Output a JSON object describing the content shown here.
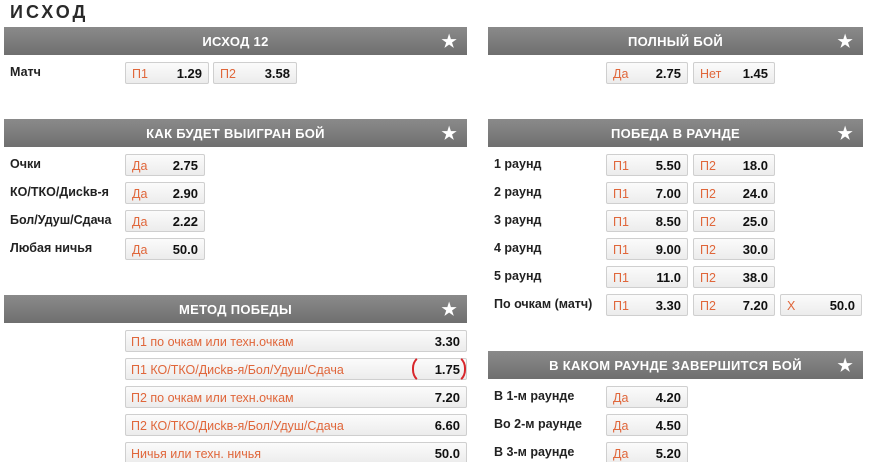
{
  "page_title": "ИСХОД",
  "panels": {
    "outcome12": {
      "title": "ИСХОД 12",
      "rows": [
        {
          "label": "Матч",
          "odds": [
            {
              "label": "П1",
              "value": "1.29"
            },
            {
              "label": "П2",
              "value": "3.58"
            }
          ]
        }
      ]
    },
    "full_fight": {
      "title": "ПОЛНЫЙ БОЙ",
      "rows": [
        {
          "label": "",
          "odds": [
            {
              "label": "Да",
              "value": "2.75"
            },
            {
              "label": "Нет",
              "value": "1.45"
            }
          ]
        }
      ]
    },
    "how_won": {
      "title": "КАК БУДЕТ ВЫИГРАН БОЙ",
      "rows": [
        {
          "label": "Очки",
          "odds": [
            {
              "label": "Да",
              "value": "2.75"
            }
          ]
        },
        {
          "label": "КО/ТКО/Дисkв-я",
          "odds": [
            {
              "label": "Да",
              "value": "2.90"
            }
          ]
        },
        {
          "label": "Бол/Удуш/Сдача",
          "odds": [
            {
              "label": "Да",
              "value": "2.22"
            }
          ]
        },
        {
          "label": "Любая ничья",
          "odds": [
            {
              "label": "Да",
              "value": "50.0"
            }
          ]
        }
      ]
    },
    "round_win": {
      "title": "ПОБЕДА В РАУНДЕ",
      "rows": [
        {
          "label": "1 раунд",
          "odds": [
            {
              "label": "П1",
              "value": "5.50"
            },
            {
              "label": "П2",
              "value": "18.0"
            }
          ]
        },
        {
          "label": "2 раунд",
          "odds": [
            {
              "label": "П1",
              "value": "7.00"
            },
            {
              "label": "П2",
              "value": "24.0"
            }
          ]
        },
        {
          "label": "3 раунд",
          "odds": [
            {
              "label": "П1",
              "value": "8.50"
            },
            {
              "label": "П2",
              "value": "25.0"
            }
          ]
        },
        {
          "label": "4 раунд",
          "odds": [
            {
              "label": "П1",
              "value": "9.00"
            },
            {
              "label": "П2",
              "value": "30.0"
            }
          ]
        },
        {
          "label": "5 раунд",
          "odds": [
            {
              "label": "П1",
              "value": "11.0"
            },
            {
              "label": "П2",
              "value": "38.0"
            }
          ]
        },
        {
          "label": "По очкам (матч)",
          "odds": [
            {
              "label": "П1",
              "value": "3.30"
            },
            {
              "label": "П2",
              "value": "7.20"
            },
            {
              "label": "Х",
              "value": "50.0"
            }
          ]
        }
      ]
    },
    "victory_method": {
      "title": "МЕТОД ПОБЕДЫ",
      "rows": [
        {
          "label": "П1 по очкам или техн.очкам",
          "value": "3.30"
        },
        {
          "label": "П1 КО/ТКО/Дисkв-я/Бол/Удуш/Сдача",
          "value": "1.75"
        },
        {
          "label": "П2 по очкам или техн.очкам",
          "value": "7.20"
        },
        {
          "label": "П2 КО/ТКО/Дисkв-я/Бол/Удуш/Сдача",
          "value": "6.60"
        },
        {
          "label": "Ничья или техн. ничья",
          "value": "50.0"
        }
      ]
    },
    "finish_round": {
      "title": "В КАКОМ РАУНДЕ ЗАВЕРШИТСЯ БОЙ",
      "rows": [
        {
          "label": "В 1-м раунде",
          "odds": [
            {
              "label": "Да",
              "value": "4.20"
            }
          ]
        },
        {
          "label": "Во 2-м раунде",
          "odds": [
            {
              "label": "Да",
              "value": "4.50"
            }
          ]
        },
        {
          "label": "В 3-м раунде",
          "odds": [
            {
              "label": "Да",
              "value": "5.20"
            }
          ]
        }
      ]
    }
  },
  "icons": {
    "favorite": "star-icon"
  },
  "colors": {
    "header_bg": "#7c7c7c",
    "odd_label": "#e0663a",
    "highlight": "#d8262b"
  }
}
